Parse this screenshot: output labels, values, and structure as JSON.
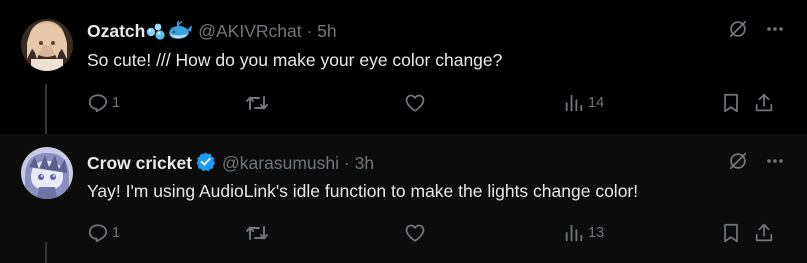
{
  "posts": [
    {
      "author_name": "Ozatch",
      "author_emojis": [
        "bubbles-emoji",
        "whale-emoji"
      ],
      "verified": false,
      "handle": "@AKIVRchat",
      "separator": "·",
      "time": "5h",
      "text": "So cute! /// How do you make your eye color change?",
      "reply_count": "1",
      "views": "14"
    },
    {
      "author_name": "Crow cricket",
      "verified": true,
      "handle": "@karasumushi",
      "separator": "·",
      "time": "3h",
      "text": "Yay! I'm using AudioLink's idle function to make the lights change color!",
      "reply_count": "1",
      "views": "13"
    }
  ],
  "colors": {
    "background": "#000000",
    "text": "#e7e9ea",
    "muted": "#71767b",
    "verified": "#1d9bf0"
  }
}
